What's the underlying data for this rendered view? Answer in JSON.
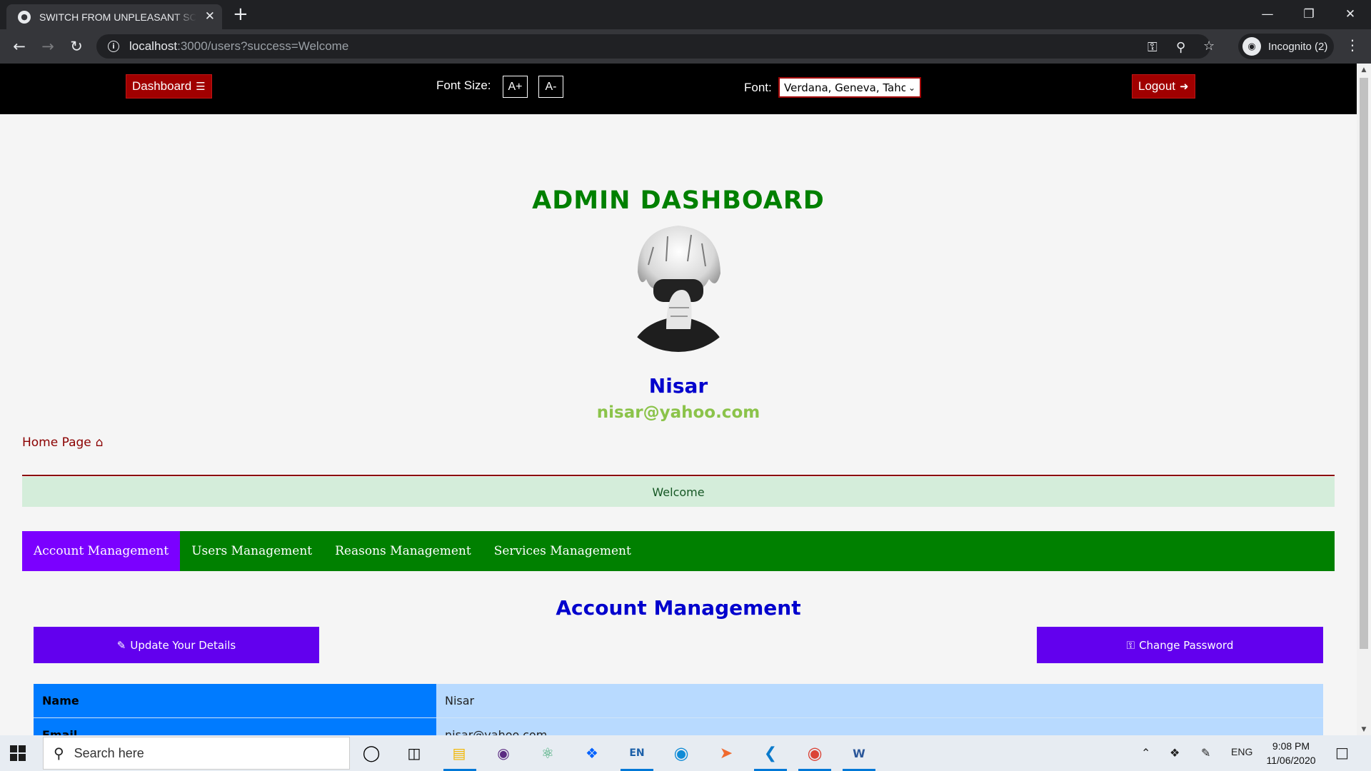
{
  "browser": {
    "tab_title": "SWITCH FROM UNPLEASANT SCENES",
    "url_host": "localhost",
    "url_rest": ":3000/users?success=Welcome",
    "incognito_label": "Incognito (2)"
  },
  "site_nav": {
    "dashboard_label": "Dashboard",
    "font_size_label": "Font Size:",
    "font_increase": "A+",
    "font_decrease": "A-",
    "font_label": "Font:",
    "font_value": "Verdana, Geneva, Tahoma, sans-serif",
    "logout_label": "Logout"
  },
  "profile": {
    "page_title": "ADMIN DASHBOARD",
    "name": "Nisar",
    "email": "nisar@yahoo.com"
  },
  "home_link": "Home Page",
  "alert": "Welcome",
  "tabs": [
    {
      "label": "Account Management",
      "active": true
    },
    {
      "label": "Users Management",
      "active": false
    },
    {
      "label": "Reasons Management",
      "active": false
    },
    {
      "label": "Services Management",
      "active": false
    }
  ],
  "account": {
    "section_title": "Account Management",
    "update_label": "Update Your Details",
    "change_password_label": "Change Password",
    "rows": [
      {
        "key": "Name",
        "value": "Nisar"
      },
      {
        "key": "Email",
        "value": "nisar@yahoo.com"
      }
    ]
  },
  "taskbar": {
    "search_placeholder": "Search here",
    "language": "ENG",
    "time": "9:08 PM",
    "date": "11/06/2020"
  },
  "colors": {
    "nav_bg": "#000000",
    "red_button": "#a00000",
    "title_green": "#008000",
    "name_blue": "#0000cd",
    "email_green": "#8bc34a",
    "tab_active": "#7b00ff",
    "action_purple": "#6200ee",
    "key_blue": "#007bff",
    "value_blue": "#b8daff"
  },
  "icons": {
    "dashboard": "list-icon",
    "logout": "sign-out-icon",
    "home": "home-icon",
    "update": "edit-icon",
    "password": "key-icon"
  }
}
